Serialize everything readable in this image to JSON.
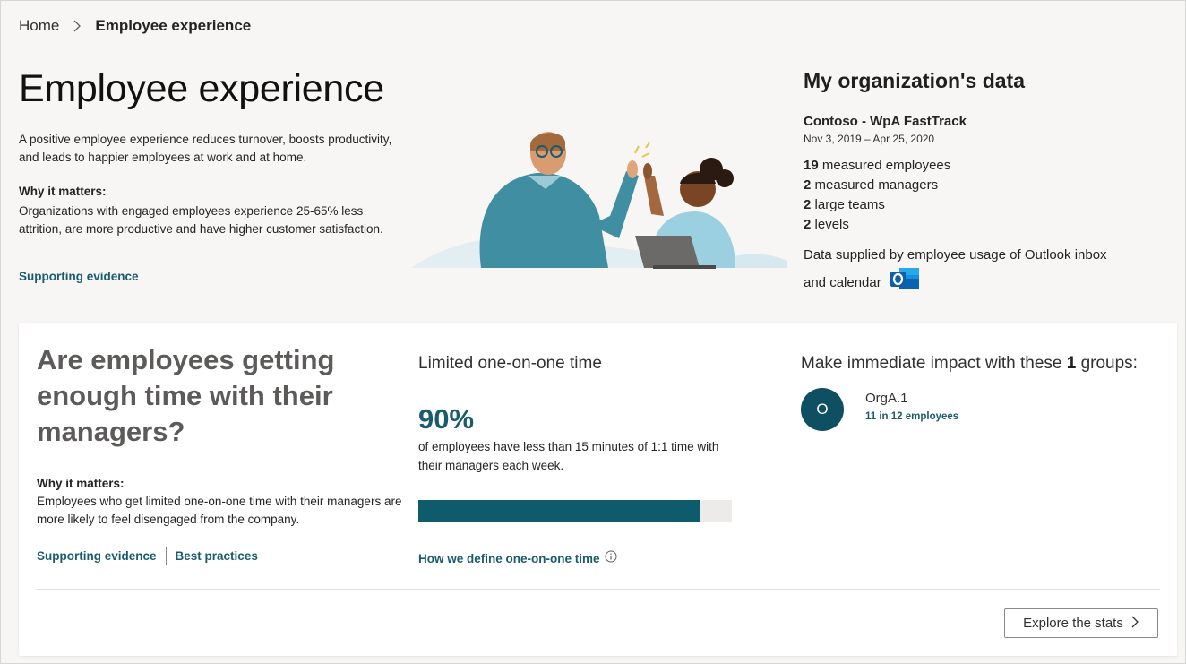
{
  "breadcrumb": {
    "home": "Home",
    "current": "Employee experience"
  },
  "hero": {
    "title": "Employee experience",
    "description": "A positive employee experience reduces turnover, boosts productivity, and leads to happier employees at work and at home.",
    "why_label": "Why it matters:",
    "why_text": "Organizations with engaged employees experience 25-65% less attrition, are more productive and have higher customer satisfaction.",
    "supporting_link": "Supporting evidence"
  },
  "org": {
    "heading": "My organization's data",
    "name": "Contoso - WpA FastTrack",
    "dates": "Nov 3, 2019 – Apr 25, 2020",
    "stats": [
      {
        "value": "19",
        "label": "measured employees"
      },
      {
        "value": "2",
        "label": "measured managers"
      },
      {
        "value": "2",
        "label": "large teams"
      },
      {
        "value": "2",
        "label": "levels"
      }
    ],
    "supplied_text": "Data supplied by employee usage of Outlook inbox and calendar",
    "icon": "outlook-icon"
  },
  "card": {
    "question": "Are employees getting enough time with their managers?",
    "why_label": "Why it matters:",
    "why_text": "Employees who get limited one-on-one time with their managers are more likely to feel disengaged from the company.",
    "links": {
      "supporting": "Supporting evidence",
      "best_practices": "Best practices"
    },
    "metric": {
      "title": "Limited one-on-one time",
      "value": "90%",
      "fraction": 0.9,
      "description": "of employees have less than 15 minutes of 1:1 time with their managers each week.",
      "define_link": "How we define one-on-one time"
    },
    "impact": {
      "title_prefix": "Make immediate impact with these ",
      "count": "1",
      "title_suffix": " groups:",
      "groups": [
        {
          "initial": "O",
          "name": "OrgA.1",
          "count": "11 in 12 employees"
        }
      ]
    },
    "explore_button": "Explore the stats"
  },
  "colors": {
    "accent": "#1a5c6d",
    "bar_fill": "#0e5b6c",
    "avatar": "#0e4f62",
    "page_bg": "#f8f6f4"
  }
}
